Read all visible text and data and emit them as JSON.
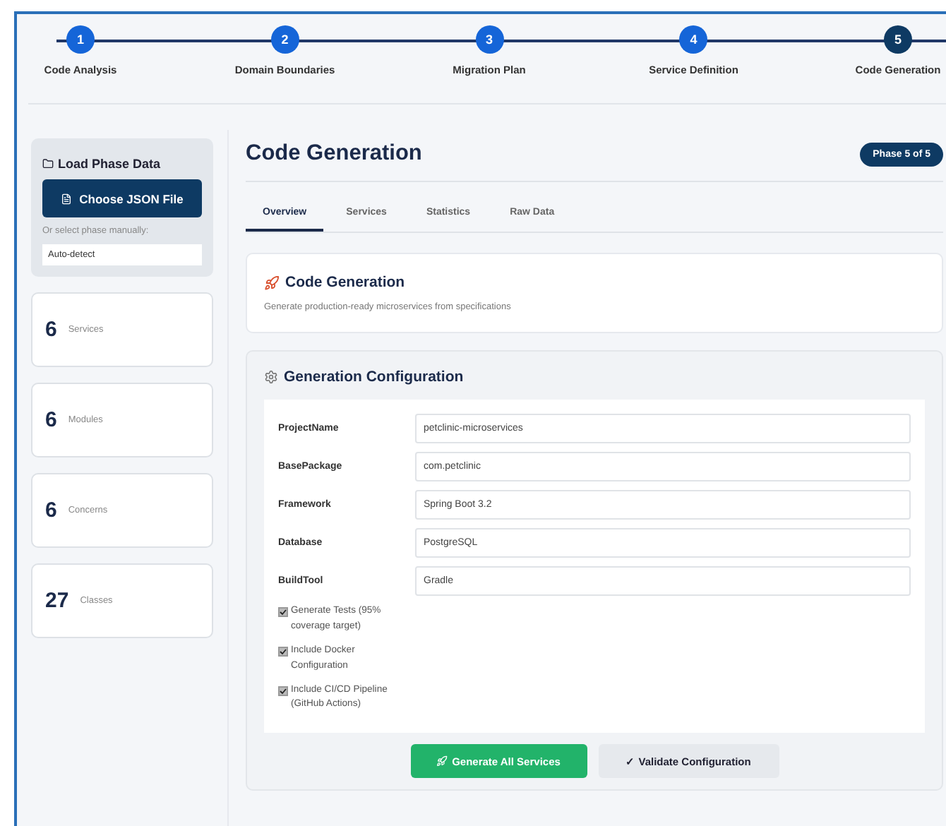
{
  "steps": [
    {
      "number": "1",
      "label": "Code Analysis",
      "current": false
    },
    {
      "number": "2",
      "label": "Domain Boundaries",
      "current": false
    },
    {
      "number": "3",
      "label": "Migration Plan",
      "current": false
    },
    {
      "number": "4",
      "label": "Service Definition",
      "current": false
    },
    {
      "number": "5",
      "label": "Code Generation",
      "current": true
    }
  ],
  "sidebar": {
    "load_title": "Load Phase Data",
    "choose_button": "Choose JSON File",
    "select_label": "Or select phase manually:",
    "select_value": "Auto-detect",
    "stats": [
      {
        "value": "6",
        "label": "Services"
      },
      {
        "value": "6",
        "label": "Modules"
      },
      {
        "value": "6",
        "label": "Concerns"
      },
      {
        "value": "27",
        "label": "Classes"
      }
    ]
  },
  "header": {
    "title": "Code Generation",
    "badge": "Phase 5 of 5"
  },
  "tabs": [
    {
      "label": "Overview",
      "selected": true
    },
    {
      "label": "Services",
      "selected": false
    },
    {
      "label": "Statistics",
      "selected": false
    },
    {
      "label": "Raw Data",
      "selected": false
    }
  ],
  "intro": {
    "title": "Code Generation",
    "description": "Generate production-ready microservices from specifications"
  },
  "config": {
    "title": "Generation Configuration",
    "fields": [
      {
        "label": "ProjectName",
        "value": "petclinic-microservices"
      },
      {
        "label": "BasePackage",
        "value": "com.petclinic"
      },
      {
        "label": "Framework",
        "value": "Spring Boot 3.2"
      },
      {
        "label": "Database",
        "value": "PostgreSQL"
      },
      {
        "label": "BuildTool",
        "value": "Gradle"
      }
    ],
    "options": [
      {
        "label": "Generate Tests (95% coverage target)",
        "checked": true
      },
      {
        "label": "Include Docker Configuration",
        "checked": true
      },
      {
        "label": "Include CI/CD Pipeline (GitHub Actions)",
        "checked": true
      }
    ]
  },
  "actions": [
    {
      "label": "Generate All Services",
      "kind": "primary"
    },
    {
      "label": "✓ Validate Configuration",
      "kind": "secondary"
    }
  ]
}
